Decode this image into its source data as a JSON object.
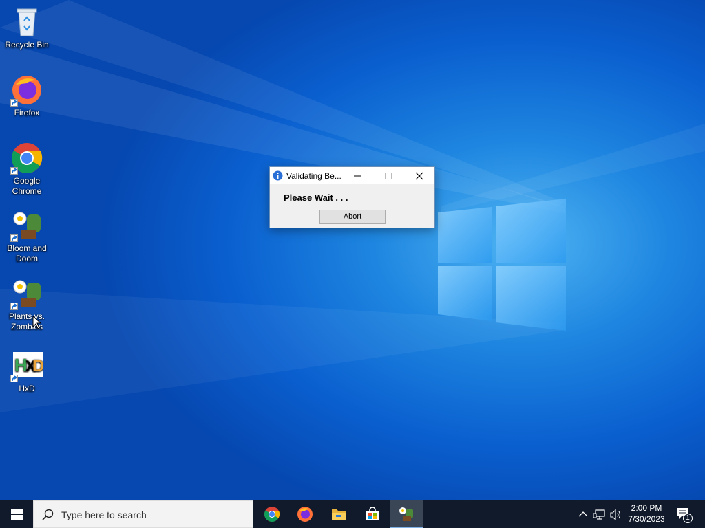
{
  "desktop": {
    "icons": [
      {
        "label": "Recycle Bin"
      },
      {
        "label": "Firefox"
      },
      {
        "label": "Google Chrome"
      },
      {
        "label": "Bloom and Doom"
      },
      {
        "label": "Plants vs. Zombies"
      },
      {
        "label": "HxD"
      }
    ]
  },
  "dialog": {
    "title": "Validating Be...",
    "message": "Please Wait . . .",
    "abort_label": "Abort"
  },
  "taskbar": {
    "search_placeholder": "Type here to search",
    "time": "2:00 PM",
    "date": "7/30/2023",
    "notification_count": "1"
  },
  "colors": {
    "accent": "#0a5fcf",
    "taskbar": "#101a2b"
  }
}
